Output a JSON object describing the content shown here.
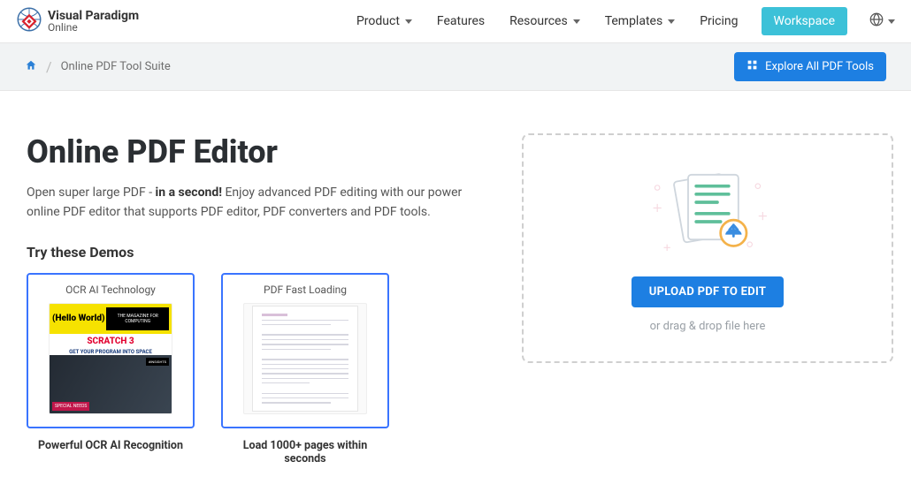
{
  "brand": {
    "l1": "Visual Paradigm",
    "l2": "Online"
  },
  "nav": {
    "product": "Product",
    "features": "Features",
    "resources": "Resources",
    "templates": "Templates",
    "pricing": "Pricing",
    "workspace": "Workspace"
  },
  "breadcrumb": {
    "current": "Online PDF Tool Suite"
  },
  "explore_btn": "Explore All PDF Tools",
  "hero": {
    "title": "Online PDF Editor",
    "desc_pre": "Open super large PDF - ",
    "desc_bold": "in a second!",
    "desc_post": " Enjoy advanced PDF editing with our power online PDF editor that supports PDF editor, PDF converters and PDF tools."
  },
  "demos": {
    "heading": "Try these Demos",
    "items": [
      {
        "card_title": "OCR AI Technology",
        "caption": "Powerful OCR AI Recognition"
      },
      {
        "card_title": "PDF Fast Loading",
        "caption": "Load 1000+ pages within seconds"
      }
    ]
  },
  "upload": {
    "button": "UPLOAD PDF TO EDIT",
    "hint": "or drag & drop file here"
  },
  "mag": {
    "hello": "(Hello World)",
    "scratch": "SCRATCH 3",
    "program": "GET YOUR PROGRAM INTO SPACE",
    "special": "SPECIAL NEEDS"
  }
}
